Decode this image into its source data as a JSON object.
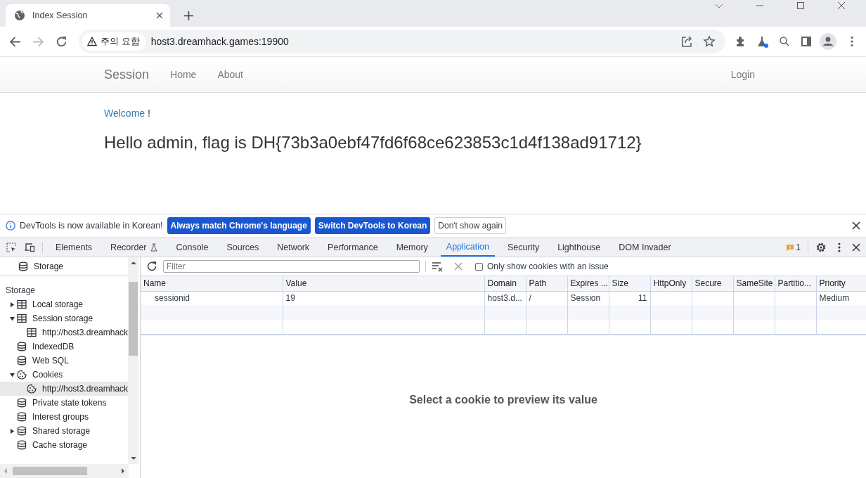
{
  "browser": {
    "tab": {
      "title": "Index Session"
    },
    "address": {
      "security_badge": "주의 요함",
      "url": "host3.dreamhack.games:19900"
    }
  },
  "page": {
    "navbar": {
      "brand": "Session",
      "links": [
        {
          "label": "Home"
        },
        {
          "label": "About"
        }
      ],
      "right_link": "Login"
    },
    "welcome": "Welcome",
    "welcome_mark": "!",
    "heading": "Hello admin, flag is DH{73b3a0ebf47fd6f68ce623853c1d4f138ad91712}"
  },
  "devtools": {
    "infobar": {
      "message": "DevTools is now available in Korean!",
      "buttons": [
        {
          "label": "Always match Chrome's language",
          "kind": "primary"
        },
        {
          "label": "Switch DevTools to Korean",
          "kind": "primary"
        },
        {
          "label": "Don't show again",
          "kind": "plain"
        }
      ]
    },
    "tabs": [
      {
        "label": "Elements",
        "selected": false,
        "kind": "plain"
      },
      {
        "label": "Recorder",
        "selected": false,
        "kind": "experimental"
      },
      {
        "label": "Console",
        "selected": false,
        "kind": "plain"
      },
      {
        "label": "Sources",
        "selected": false,
        "kind": "plain"
      },
      {
        "label": "Network",
        "selected": false,
        "kind": "plain"
      },
      {
        "label": "Performance",
        "selected": false,
        "kind": "plain"
      },
      {
        "label": "Memory",
        "selected": false,
        "kind": "plain"
      },
      {
        "label": "Application",
        "selected": true,
        "kind": "plain"
      },
      {
        "label": "Security",
        "selected": false,
        "kind": "plain"
      },
      {
        "label": "Lighthouse",
        "selected": false,
        "kind": "plain"
      },
      {
        "label": "DOM Invader",
        "selected": false,
        "kind": "plain"
      }
    ],
    "issues_count": "1",
    "sidebar": {
      "top_item": {
        "label": "Storage",
        "kind": "database"
      },
      "section": "Storage",
      "items": [
        {
          "label": "Local storage",
          "kind": "table",
          "expanded": false,
          "selected": false
        },
        {
          "label": "Session storage",
          "kind": "table",
          "expanded": true,
          "selected": false,
          "children": [
            {
              "label": "http://host3.dreamhack",
              "kind": "table",
              "selected": false
            }
          ]
        },
        {
          "label": "IndexedDB",
          "kind": "database",
          "selected": false
        },
        {
          "label": "Web SQL",
          "kind": "database",
          "selected": false
        },
        {
          "label": "Cookies",
          "kind": "cookie",
          "expanded": true,
          "selected": false,
          "children": [
            {
              "label": "http://host3.dreamhack",
              "kind": "cookie",
              "selected": true
            }
          ]
        },
        {
          "label": "Private state tokens",
          "kind": "database",
          "selected": false
        },
        {
          "label": "Interest groups",
          "kind": "database",
          "selected": false
        },
        {
          "label": "Shared storage",
          "kind": "database",
          "expanded": false,
          "selected": false
        },
        {
          "label": "Cache storage",
          "kind": "database",
          "selected": false
        }
      ]
    },
    "filter": {
      "placeholder": "Filter"
    },
    "issue_only": {
      "label": "Only show cookies with an issue",
      "checked": false
    },
    "table": {
      "columns": [
        "Name",
        "Value",
        "Domain",
        "Path",
        "Expires ...",
        "Size",
        "HttpOnly",
        "Secure",
        "SameSite",
        "Partitio...",
        "Priority"
      ],
      "rows": [
        [
          "sessionid",
          "19",
          "host3.d...",
          "/",
          "Session",
          "11",
          "",
          "",
          "",
          "",
          "Medium"
        ]
      ]
    },
    "preview_message": "Select a cookie to preview its value"
  }
}
